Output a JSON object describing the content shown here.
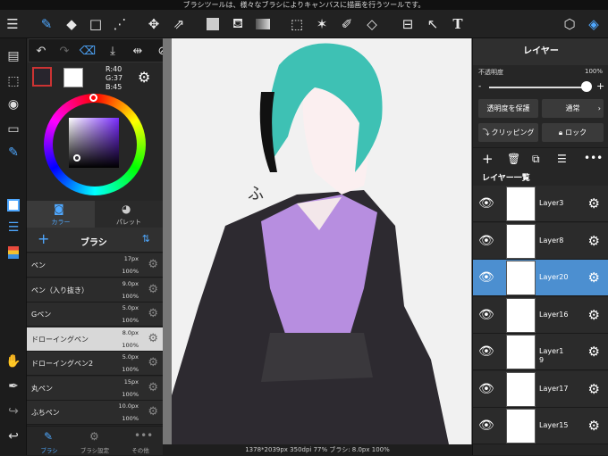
{
  "tip": "ブラシツールは、様々なブラシによりキャンバスに描画を行うツールです。",
  "toolbar": {
    "icons": [
      "menu-icon",
      "brush-tool-icon",
      "eraser-icon",
      "rectangle-icon",
      "transform-icon",
      "move-icon",
      "transform-box-icon",
      "fill-color-icon",
      "bucket-icon",
      "gradient-icon",
      "select-rect-icon",
      "magic-wand-icon",
      "select-pen-icon",
      "select-eraser-icon",
      "frame-icon",
      "operation-icon",
      "text-icon",
      "material-icon",
      "layer-icon"
    ],
    "text_label": "T"
  },
  "color": {
    "r": "R:40",
    "g": "G:37",
    "b": "B:45",
    "main_hex": "#28252d",
    "tab_color": "カラー",
    "tab_palette": "パレット"
  },
  "brush": {
    "title": "ブラシ",
    "items": [
      {
        "name": "ペン",
        "size": "17px",
        "opacity": "100%"
      },
      {
        "name": "ペン（入り抜き）",
        "size": "9.0px",
        "opacity": "100%"
      },
      {
        "name": "Gペン",
        "size": "5.0px",
        "opacity": "100%"
      },
      {
        "name": "ドローイングペン",
        "size": "8.0px",
        "opacity": "100%"
      },
      {
        "name": "ドローイングペン2",
        "size": "5.0px",
        "opacity": "100%"
      },
      {
        "name": "丸ペン",
        "size": "15px",
        "opacity": "100%"
      },
      {
        "name": "ふちペン",
        "size": "10.0px",
        "opacity": "100%"
      }
    ],
    "selected": 3,
    "tabs": [
      "ブラシ",
      "ブラシ設定",
      "その他"
    ]
  },
  "layers": {
    "title": "レイヤー",
    "opacity_label": "不透明度",
    "opacity_value": "100%",
    "protect": "透明度を保護",
    "blend": "通常",
    "clipping": "クリッピング",
    "lock": "ロック",
    "list_title": "レイヤー一覧",
    "items": [
      "Layer3",
      "Layer8",
      "Layer20",
      "Layer16",
      "Layer1\n9",
      "Layer17",
      "Layer15"
    ],
    "selected": 2
  },
  "status": "1378*2039px 350dpi 77% ブラシ: 8.0px 100%"
}
